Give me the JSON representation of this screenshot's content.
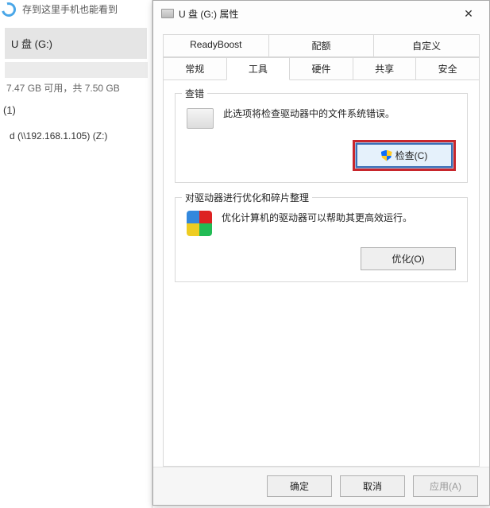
{
  "left": {
    "header_hint": "存到这里手机也能看到",
    "drive_name": "U 盘 (G:)",
    "space_text": "7.47 GB 可用，共 7.50 GB",
    "section_label": "(1)",
    "net_drive": "d (\\\\192.168.1.105) (Z:)"
  },
  "dialog": {
    "title": "U 盘 (G:) 属性",
    "tabs_row1": [
      "ReadyBoost",
      "配额",
      "自定义"
    ],
    "tabs_row2": [
      "常规",
      "工具",
      "硬件",
      "共享",
      "安全"
    ],
    "active_tab": "工具",
    "group1": {
      "title": "查错",
      "desc": "此选项将检查驱动器中的文件系统错误。",
      "button": "检查(C)"
    },
    "group2": {
      "title": "对驱动器进行优化和碎片整理",
      "desc": "优化计算机的驱动器可以帮助其更高效运行。",
      "button": "优化(O)"
    },
    "buttons": {
      "ok": "确定",
      "cancel": "取消",
      "apply": "应用(A)"
    }
  }
}
